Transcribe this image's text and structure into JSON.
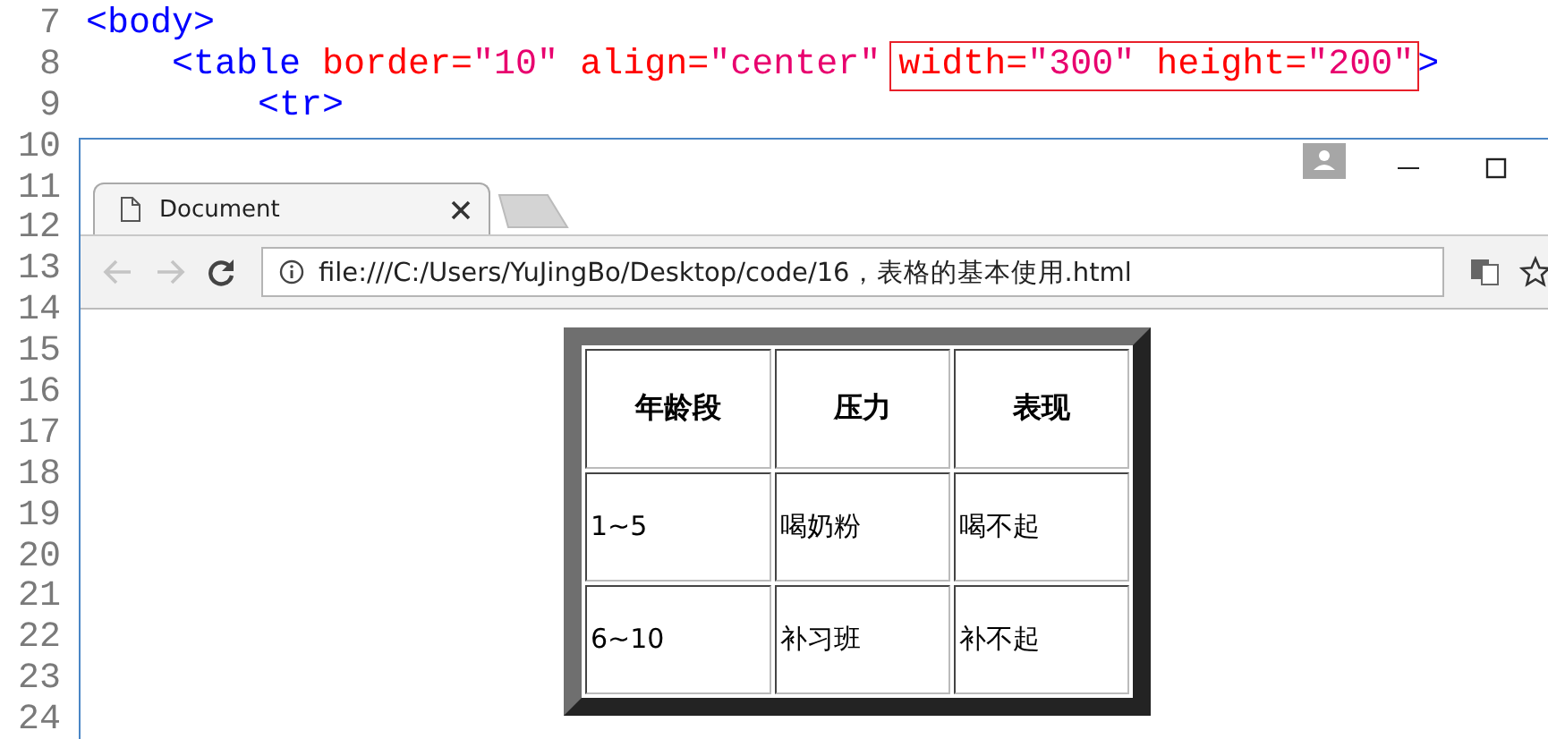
{
  "editor": {
    "lines": [
      {
        "number": "7",
        "parts": [
          {
            "boxed": false,
            "tokens": [
              {
                "kind": "tag",
                "text": "<body>"
              }
            ]
          }
        ]
      },
      {
        "number": "8",
        "parts": [
          {
            "boxed": false,
            "tokens": [
              {
                "kind": "tag",
                "text": "    <table"
              },
              {
                "kind": "attr",
                "text": " border="
              },
              {
                "kind": "value",
                "text": "\"10\""
              },
              {
                "kind": "attr",
                "text": " align="
              },
              {
                "kind": "value",
                "text": "\"center\""
              }
            ]
          },
          {
            "boxed": true,
            "tokens": [
              {
                "kind": "attr",
                "text": "width="
              },
              {
                "kind": "value",
                "text": "\"300\""
              },
              {
                "kind": "attr",
                "text": " height="
              },
              {
                "kind": "value",
                "text": "\"200\""
              }
            ]
          },
          {
            "boxed": false,
            "tokens": [
              {
                "kind": "tag",
                "text": ">"
              }
            ]
          }
        ]
      },
      {
        "number": "9",
        "parts": [
          {
            "boxed": false,
            "tokens": [
              {
                "kind": "tag",
                "text": "        <tr>"
              }
            ]
          }
        ]
      },
      {
        "number": "10"
      },
      {
        "number": "11"
      },
      {
        "number": "12"
      },
      {
        "number": "13"
      },
      {
        "number": "14"
      },
      {
        "number": "15"
      },
      {
        "number": "16"
      },
      {
        "number": "17"
      },
      {
        "number": "18"
      },
      {
        "number": "19"
      },
      {
        "number": "20"
      },
      {
        "number": "21"
      },
      {
        "number": "22"
      },
      {
        "number": "23"
      },
      {
        "number": "24"
      }
    ]
  },
  "browser": {
    "tabs": [
      {
        "title": "Document",
        "selected": true
      }
    ],
    "toolbar": {
      "back": {
        "disabled": true
      },
      "forward": {
        "disabled": true
      },
      "url": "file:///C:/Users/YuJingBo/Desktop/code/16，表格的基本使用.html"
    },
    "page": {
      "table": {
        "columns": [
          "年龄段",
          "压力",
          "表现"
        ],
        "rows": [
          [
            "1~5",
            "喝奶粉",
            "喝不起"
          ],
          [
            "6~10",
            "补习班",
            "补不起"
          ]
        ]
      }
    }
  }
}
